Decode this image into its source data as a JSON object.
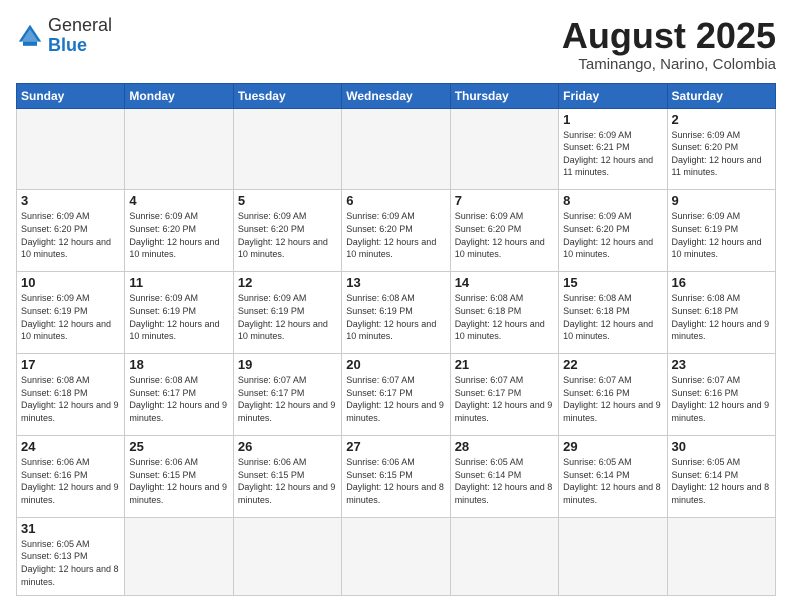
{
  "header": {
    "logo": {
      "general": "General",
      "blue": "Blue"
    },
    "month_year": "August 2025",
    "location": "Taminango, Narino, Colombia"
  },
  "weekdays": [
    "Sunday",
    "Monday",
    "Tuesday",
    "Wednesday",
    "Thursday",
    "Friday",
    "Saturday"
  ],
  "weeks": [
    [
      {
        "day": "",
        "info": "",
        "empty": true
      },
      {
        "day": "",
        "info": "",
        "empty": true
      },
      {
        "day": "",
        "info": "",
        "empty": true
      },
      {
        "day": "",
        "info": "",
        "empty": true
      },
      {
        "day": "",
        "info": "",
        "empty": true
      },
      {
        "day": "1",
        "info": "Sunrise: 6:09 AM\nSunset: 6:21 PM\nDaylight: 12 hours and 11 minutes."
      },
      {
        "day": "2",
        "info": "Sunrise: 6:09 AM\nSunset: 6:20 PM\nDaylight: 12 hours and 11 minutes."
      }
    ],
    [
      {
        "day": "3",
        "info": "Sunrise: 6:09 AM\nSunset: 6:20 PM\nDaylight: 12 hours and 10 minutes."
      },
      {
        "day": "4",
        "info": "Sunrise: 6:09 AM\nSunset: 6:20 PM\nDaylight: 12 hours and 10 minutes."
      },
      {
        "day": "5",
        "info": "Sunrise: 6:09 AM\nSunset: 6:20 PM\nDaylight: 12 hours and 10 minutes."
      },
      {
        "day": "6",
        "info": "Sunrise: 6:09 AM\nSunset: 6:20 PM\nDaylight: 12 hours and 10 minutes."
      },
      {
        "day": "7",
        "info": "Sunrise: 6:09 AM\nSunset: 6:20 PM\nDaylight: 12 hours and 10 minutes."
      },
      {
        "day": "8",
        "info": "Sunrise: 6:09 AM\nSunset: 6:20 PM\nDaylight: 12 hours and 10 minutes."
      },
      {
        "day": "9",
        "info": "Sunrise: 6:09 AM\nSunset: 6:19 PM\nDaylight: 12 hours and 10 minutes."
      }
    ],
    [
      {
        "day": "10",
        "info": "Sunrise: 6:09 AM\nSunset: 6:19 PM\nDaylight: 12 hours and 10 minutes."
      },
      {
        "day": "11",
        "info": "Sunrise: 6:09 AM\nSunset: 6:19 PM\nDaylight: 12 hours and 10 minutes."
      },
      {
        "day": "12",
        "info": "Sunrise: 6:09 AM\nSunset: 6:19 PM\nDaylight: 12 hours and 10 minutes."
      },
      {
        "day": "13",
        "info": "Sunrise: 6:08 AM\nSunset: 6:19 PM\nDaylight: 12 hours and 10 minutes."
      },
      {
        "day": "14",
        "info": "Sunrise: 6:08 AM\nSunset: 6:18 PM\nDaylight: 12 hours and 10 minutes."
      },
      {
        "day": "15",
        "info": "Sunrise: 6:08 AM\nSunset: 6:18 PM\nDaylight: 12 hours and 10 minutes."
      },
      {
        "day": "16",
        "info": "Sunrise: 6:08 AM\nSunset: 6:18 PM\nDaylight: 12 hours and 9 minutes."
      }
    ],
    [
      {
        "day": "17",
        "info": "Sunrise: 6:08 AM\nSunset: 6:18 PM\nDaylight: 12 hours and 9 minutes."
      },
      {
        "day": "18",
        "info": "Sunrise: 6:08 AM\nSunset: 6:17 PM\nDaylight: 12 hours and 9 minutes."
      },
      {
        "day": "19",
        "info": "Sunrise: 6:07 AM\nSunset: 6:17 PM\nDaylight: 12 hours and 9 minutes."
      },
      {
        "day": "20",
        "info": "Sunrise: 6:07 AM\nSunset: 6:17 PM\nDaylight: 12 hours and 9 minutes."
      },
      {
        "day": "21",
        "info": "Sunrise: 6:07 AM\nSunset: 6:17 PM\nDaylight: 12 hours and 9 minutes."
      },
      {
        "day": "22",
        "info": "Sunrise: 6:07 AM\nSunset: 6:16 PM\nDaylight: 12 hours and 9 minutes."
      },
      {
        "day": "23",
        "info": "Sunrise: 6:07 AM\nSunset: 6:16 PM\nDaylight: 12 hours and 9 minutes."
      }
    ],
    [
      {
        "day": "24",
        "info": "Sunrise: 6:06 AM\nSunset: 6:16 PM\nDaylight: 12 hours and 9 minutes."
      },
      {
        "day": "25",
        "info": "Sunrise: 6:06 AM\nSunset: 6:15 PM\nDaylight: 12 hours and 9 minutes."
      },
      {
        "day": "26",
        "info": "Sunrise: 6:06 AM\nSunset: 6:15 PM\nDaylight: 12 hours and 9 minutes."
      },
      {
        "day": "27",
        "info": "Sunrise: 6:06 AM\nSunset: 6:15 PM\nDaylight: 12 hours and 8 minutes."
      },
      {
        "day": "28",
        "info": "Sunrise: 6:05 AM\nSunset: 6:14 PM\nDaylight: 12 hours and 8 minutes."
      },
      {
        "day": "29",
        "info": "Sunrise: 6:05 AM\nSunset: 6:14 PM\nDaylight: 12 hours and 8 minutes."
      },
      {
        "day": "30",
        "info": "Sunrise: 6:05 AM\nSunset: 6:14 PM\nDaylight: 12 hours and 8 minutes."
      }
    ],
    [
      {
        "day": "31",
        "info": "Sunrise: 6:05 AM\nSunset: 6:13 PM\nDaylight: 12 hours and 8 minutes."
      },
      {
        "day": "",
        "info": "",
        "empty": true
      },
      {
        "day": "",
        "info": "",
        "empty": true
      },
      {
        "day": "",
        "info": "",
        "empty": true
      },
      {
        "day": "",
        "info": "",
        "empty": true
      },
      {
        "day": "",
        "info": "",
        "empty": true
      },
      {
        "day": "",
        "info": "",
        "empty": true
      }
    ]
  ]
}
